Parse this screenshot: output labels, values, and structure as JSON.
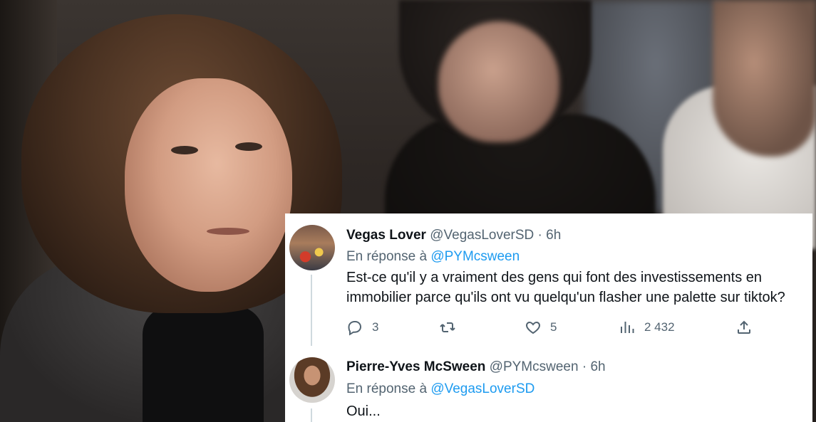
{
  "tweets": [
    {
      "name": "Vegas Lover",
      "handle": "@VegasLoverSD",
      "sep": " · ",
      "time": "6h",
      "reply_prefix": "En réponse à ",
      "reply_to": "@PYMcsween",
      "text_line1": "Est-ce qu'il y a vraiment des gens qui font des investissements en",
      "text_line2": "immobilier parce qu'ils ont vu quelqu'un flasher une palette sur tiktok?",
      "replies": "3",
      "retweets": "",
      "likes": "5",
      "views": "2 432",
      "icons": [
        "reply-icon",
        "retweet-icon",
        "like-icon",
        "views-icon",
        "share-icon"
      ]
    },
    {
      "name": "Pierre-Yves McSween",
      "handle": "@PYMcsween",
      "sep": " · ",
      "time": "6h",
      "reply_prefix": "En réponse à ",
      "reply_to": "@VegasLoverSD",
      "text_line1": "Oui..."
    }
  ],
  "colors": {
    "link": "#1d9bf0",
    "secondary": "#536471",
    "text": "#0f1419"
  }
}
